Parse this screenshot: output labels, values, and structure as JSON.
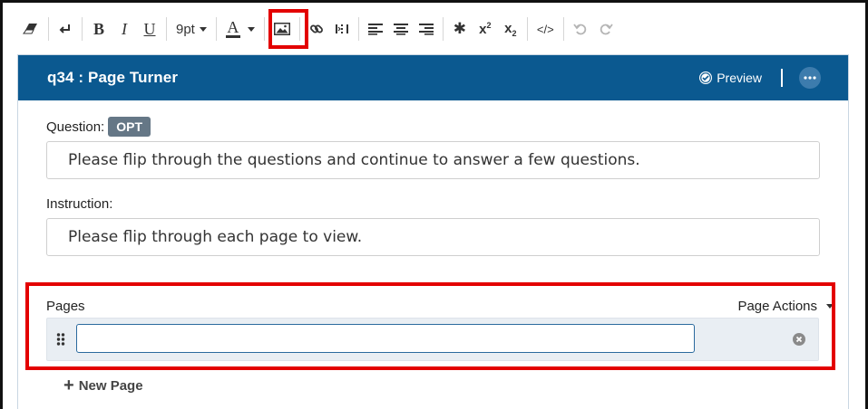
{
  "toolbar": {
    "font_size": "9pt",
    "text_color_glyph": "A",
    "bold_glyph": "B",
    "italic_glyph": "I",
    "underline_glyph": "U",
    "superscript_base": "x",
    "superscript_sup": "2",
    "subscript_base": "x",
    "subscript_sub": "2",
    "special_char": "✱",
    "source_code": "</>"
  },
  "panel": {
    "title": "q34 : Page Turner",
    "preview_label": "Preview"
  },
  "question": {
    "label": "Question:",
    "badge": "OPT",
    "value": "Please flip through the questions and continue to answer a few questions."
  },
  "instruction": {
    "label": "Instruction:",
    "value": "Please flip through each page to view."
  },
  "pages": {
    "label": "Pages",
    "actions_label": "Page Actions",
    "items": [
      {
        "value": ""
      }
    ],
    "new_page_label": "New Page"
  },
  "colors": {
    "header": "#0b5990",
    "highlight": "#e30000",
    "badge": "#657786"
  }
}
